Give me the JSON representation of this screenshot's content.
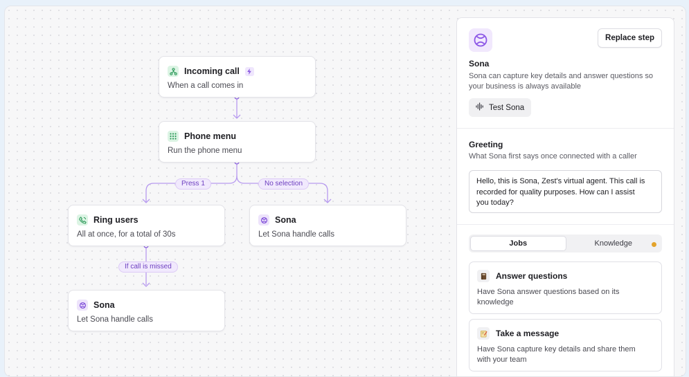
{
  "flow": {
    "incoming": {
      "title": "Incoming call",
      "subtitle": "When a call comes in",
      "icon": "phone-tree-icon",
      "badge_icon": "bolt-icon"
    },
    "phone_menu": {
      "title": "Phone menu",
      "subtitle": "Run the phone menu",
      "icon": "keypad-icon"
    },
    "ring_users": {
      "title": "Ring users",
      "subtitle": "All at once, for a total of 30s",
      "icon": "phone-ring-icon"
    },
    "sona_right": {
      "title": "Sona",
      "subtitle": "Let Sona handle calls",
      "icon": "sona-icon"
    },
    "sona_bottom": {
      "title": "Sona",
      "subtitle": "Let Sona handle calls",
      "icon": "sona-icon"
    },
    "labels": {
      "press1": "Press 1",
      "no_selection": "No selection",
      "if_missed": "If call is missed"
    }
  },
  "panel": {
    "replace_label": "Replace step",
    "agent_name": "Sona",
    "agent_desc_line1": "Sona can capture key details and answer questions so",
    "agent_desc_line2": "your business is always available",
    "test_label": "Test Sona",
    "greeting_title": "Greeting",
    "greeting_desc": "What Sona first says once connected with a caller",
    "greeting_line1": "Hello, this is Sona, Zest's virtual agent. This call is",
    "greeting_line2": "recorded for quality purposes. How can I assist",
    "greeting_line3": "you today?",
    "tabs": [
      {
        "label": "Jobs",
        "active": true
      },
      {
        "label": "Knowledge",
        "active": false,
        "has_dot": true
      }
    ],
    "jobs": [
      {
        "title": "Answer questions",
        "desc_line1": "Have Sona answer questions based on its",
        "desc_line2": "knowledge",
        "icon": "book-icon"
      },
      {
        "title": "Take a message",
        "desc_line1": "Have Sona capture key details and share them",
        "desc_line2": "with your team",
        "icon": "notepad-icon"
      }
    ]
  },
  "colors": {
    "accent": "#7c4ad8",
    "connector": "#b79aef",
    "green_icon": "#2f9a5b",
    "dot": "#e3a32b"
  }
}
